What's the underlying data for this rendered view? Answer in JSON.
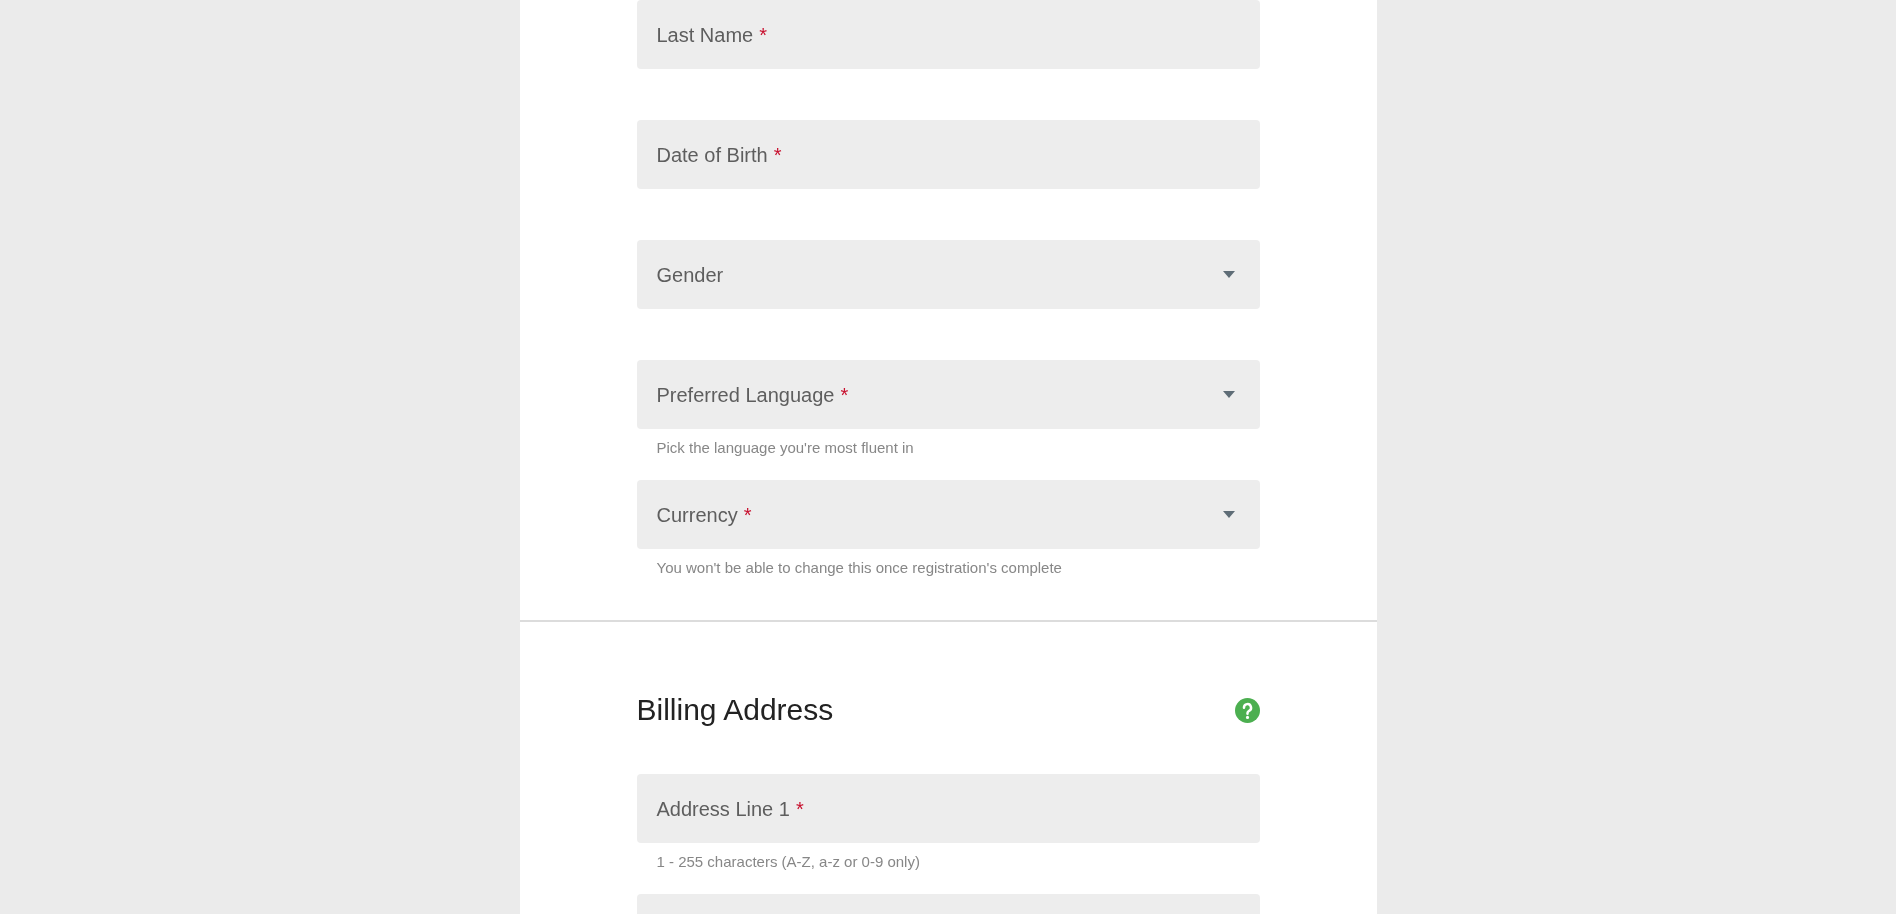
{
  "sections": [
    {
      "fields": [
        {
          "kind": "text",
          "label": "Last Name",
          "required_mark": "*"
        },
        {
          "kind": "text",
          "label": "Date of Birth",
          "required_mark": "*"
        },
        {
          "kind": "select",
          "label": "Gender"
        },
        {
          "kind": "select",
          "label": "Preferred Language",
          "required_mark": "*",
          "hint": "Pick the language you're most fluent in"
        },
        {
          "kind": "select",
          "label": "Currency",
          "required_mark": "*",
          "hint": "You won't be able to change this once registration's complete"
        }
      ]
    },
    {
      "title": "Billing Address",
      "help": true,
      "fields": [
        {
          "kind": "text",
          "label": "Address Line 1",
          "required_mark": "*",
          "hint": "1 - 255 characters (A-Z, a-z or 0-9 only)"
        },
        {
          "kind": "text"
        }
      ]
    }
  ]
}
